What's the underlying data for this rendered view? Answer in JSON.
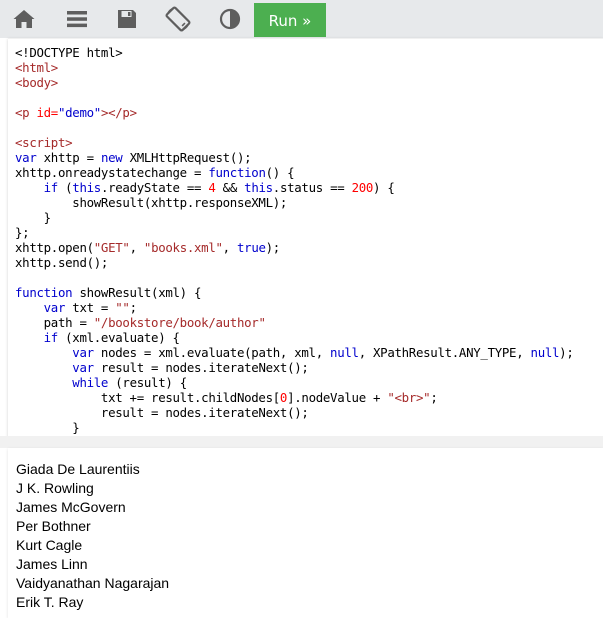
{
  "toolbar": {
    "icons": [
      "home-icon",
      "menu-icon",
      "save-icon",
      "rotate-icon",
      "contrast-icon"
    ],
    "run_label": "Run »",
    "run_color": "#4caf50"
  },
  "code_lines": [
    [
      {
        "t": "<!DOCTYPE html>",
        "c": ""
      }
    ],
    [
      {
        "t": "<html>",
        "c": "c-tag"
      }
    ],
    [
      {
        "t": "<body>",
        "c": "c-tag"
      }
    ],
    [],
    [
      {
        "t": "<p ",
        "c": "c-tag"
      },
      {
        "t": "id=",
        "c": "c-attr"
      },
      {
        "t": "\"demo\"",
        "c": "c-aval"
      },
      {
        "t": "></p>",
        "c": "c-tag"
      }
    ],
    [],
    [
      {
        "t": "<script>",
        "c": "c-tag"
      }
    ],
    [
      {
        "t": "var",
        "c": "c-kw"
      },
      {
        "t": " xhttp = ",
        "c": ""
      },
      {
        "t": "new",
        "c": "c-kw"
      },
      {
        "t": " XMLHttpRequest();",
        "c": ""
      }
    ],
    [
      {
        "t": "xhttp.onreadystatechange = ",
        "c": ""
      },
      {
        "t": "function",
        "c": "c-kw"
      },
      {
        "t": "() {",
        "c": ""
      }
    ],
    [
      {
        "t": "    ",
        "c": ""
      },
      {
        "t": "if",
        "c": "c-kw"
      },
      {
        "t": " (",
        "c": ""
      },
      {
        "t": "this",
        "c": "c-kw"
      },
      {
        "t": ".readyState == ",
        "c": ""
      },
      {
        "t": "4",
        "c": "c-num"
      },
      {
        "t": " && ",
        "c": ""
      },
      {
        "t": "this",
        "c": "c-kw"
      },
      {
        "t": ".status == ",
        "c": ""
      },
      {
        "t": "200",
        "c": "c-num"
      },
      {
        "t": ") {",
        "c": ""
      }
    ],
    [
      {
        "t": "        showResult(xhttp.responseXML);",
        "c": ""
      }
    ],
    [
      {
        "t": "    }",
        "c": ""
      }
    ],
    [
      {
        "t": "};",
        "c": ""
      }
    ],
    [
      {
        "t": "xhttp.open(",
        "c": ""
      },
      {
        "t": "\"GET\"",
        "c": "c-str"
      },
      {
        "t": ", ",
        "c": ""
      },
      {
        "t": "\"books.xml\"",
        "c": "c-str"
      },
      {
        "t": ", ",
        "c": ""
      },
      {
        "t": "true",
        "c": "c-kw"
      },
      {
        "t": ");",
        "c": ""
      }
    ],
    [
      {
        "t": "xhttp.send();",
        "c": ""
      }
    ],
    [],
    [
      {
        "t": "function",
        "c": "c-kw"
      },
      {
        "t": " showResult(xml) {",
        "c": ""
      }
    ],
    [
      {
        "t": "    ",
        "c": ""
      },
      {
        "t": "var",
        "c": "c-kw"
      },
      {
        "t": " txt = ",
        "c": ""
      },
      {
        "t": "\"\"",
        "c": "c-str"
      },
      {
        "t": ";",
        "c": ""
      }
    ],
    [
      {
        "t": "    path = ",
        "c": ""
      },
      {
        "t": "\"/bookstore/book/author\"",
        "c": "c-str"
      }
    ],
    [
      {
        "t": "    ",
        "c": ""
      },
      {
        "t": "if",
        "c": "c-kw"
      },
      {
        "t": " (xml.evaluate) {",
        "c": ""
      }
    ],
    [
      {
        "t": "        ",
        "c": ""
      },
      {
        "t": "var",
        "c": "c-kw"
      },
      {
        "t": " nodes = xml.evaluate(path, xml, ",
        "c": ""
      },
      {
        "t": "null",
        "c": "c-kw"
      },
      {
        "t": ", XPathResult.ANY_TYPE, ",
        "c": ""
      },
      {
        "t": "null",
        "c": "c-kw"
      },
      {
        "t": ");",
        "c": ""
      }
    ],
    [
      {
        "t": "        ",
        "c": ""
      },
      {
        "t": "var",
        "c": "c-kw"
      },
      {
        "t": " result = nodes.iterateNext();",
        "c": ""
      }
    ],
    [
      {
        "t": "        ",
        "c": ""
      },
      {
        "t": "while",
        "c": "c-kw"
      },
      {
        "t": " (result) {",
        "c": ""
      }
    ],
    [
      {
        "t": "            txt += result.childNodes[",
        "c": ""
      },
      {
        "t": "0",
        "c": "c-num"
      },
      {
        "t": "].nodeValue + ",
        "c": ""
      },
      {
        "t": "\"<br>\"",
        "c": "c-str"
      },
      {
        "t": ";",
        "c": ""
      }
    ],
    [
      {
        "t": "            result = nodes.iterateNext();",
        "c": ""
      }
    ],
    [
      {
        "t": "        }",
        "c": ""
      }
    ]
  ],
  "output": {
    "authors": [
      "Giada De Laurentiis",
      "J K. Rowling",
      "James McGovern",
      "Per Bothner",
      "Kurt Cagle",
      "James Linn",
      "Vaidyanathan Nagarajan",
      "Erik T. Ray"
    ]
  }
}
